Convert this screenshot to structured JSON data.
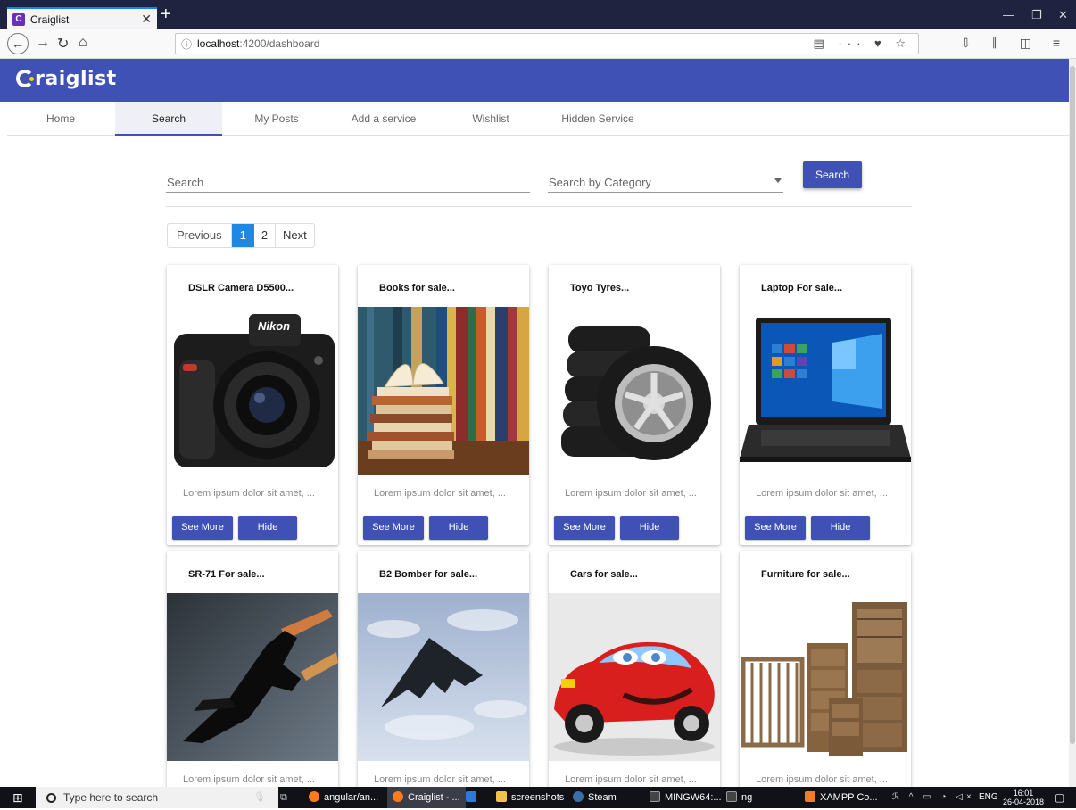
{
  "browser": {
    "tab_title": "Craiglist",
    "tab_favicon": "C",
    "url_host": "localhost",
    "url_path": ":4200/dashboard"
  },
  "app": {
    "logo": "raiglist",
    "nav": [
      "Home",
      "Search",
      "My Posts",
      "Add a service",
      "Wishlist",
      "Hidden Service"
    ],
    "active_nav": "Search",
    "accent": "#3f51b5"
  },
  "search": {
    "placeholder": "Search",
    "category_placeholder": "Search by Category",
    "button": "Search"
  },
  "pagination": {
    "prev": "Previous",
    "current": "1",
    "page2": "2",
    "next": "Next"
  },
  "cards": [
    {
      "title": "DSLR Camera D5500...",
      "desc": "Lorem ipsum dolor sit amet, ...",
      "see": "See More",
      "hide": "Hide",
      "image": "camera"
    },
    {
      "title": "Books for sale...",
      "desc": "Lorem ipsum dolor sit amet, ...",
      "see": "See More",
      "hide": "Hide",
      "image": "books"
    },
    {
      "title": "Toyo Tyres...",
      "desc": "Lorem ipsum dolor sit amet, ...",
      "see": "See More",
      "hide": "Hide",
      "image": "tyres"
    },
    {
      "title": "Laptop For sale...",
      "desc": "Lorem ipsum dolor sit amet, ...",
      "see": "See More",
      "hide": "Hide",
      "image": "laptop"
    },
    {
      "title": "SR-71 For sale...",
      "desc": "Lorem ipsum dolor sit amet, ...",
      "image": "sr71"
    },
    {
      "title": "B2 Bomber for sale...",
      "desc": "Lorem ipsum dolor sit amet, ...",
      "image": "b2"
    },
    {
      "title": "Cars for sale...",
      "desc": "Lorem ipsum dolor sit amet, ...",
      "image": "car"
    },
    {
      "title": "Furniture for sale...",
      "desc": "Lorem ipsum dolor sit amet, ...",
      "image": "furniture"
    }
  ],
  "taskbar": {
    "search_placeholder": "Type here to search",
    "items": [
      "angular/an...",
      "Craiglist - ...",
      "screenshots",
      "Steam",
      "MINGW64:...",
      "ng",
      "XAMPP Co..."
    ],
    "lang": "ENG",
    "time": "16:01",
    "date": "26-04-2018"
  }
}
